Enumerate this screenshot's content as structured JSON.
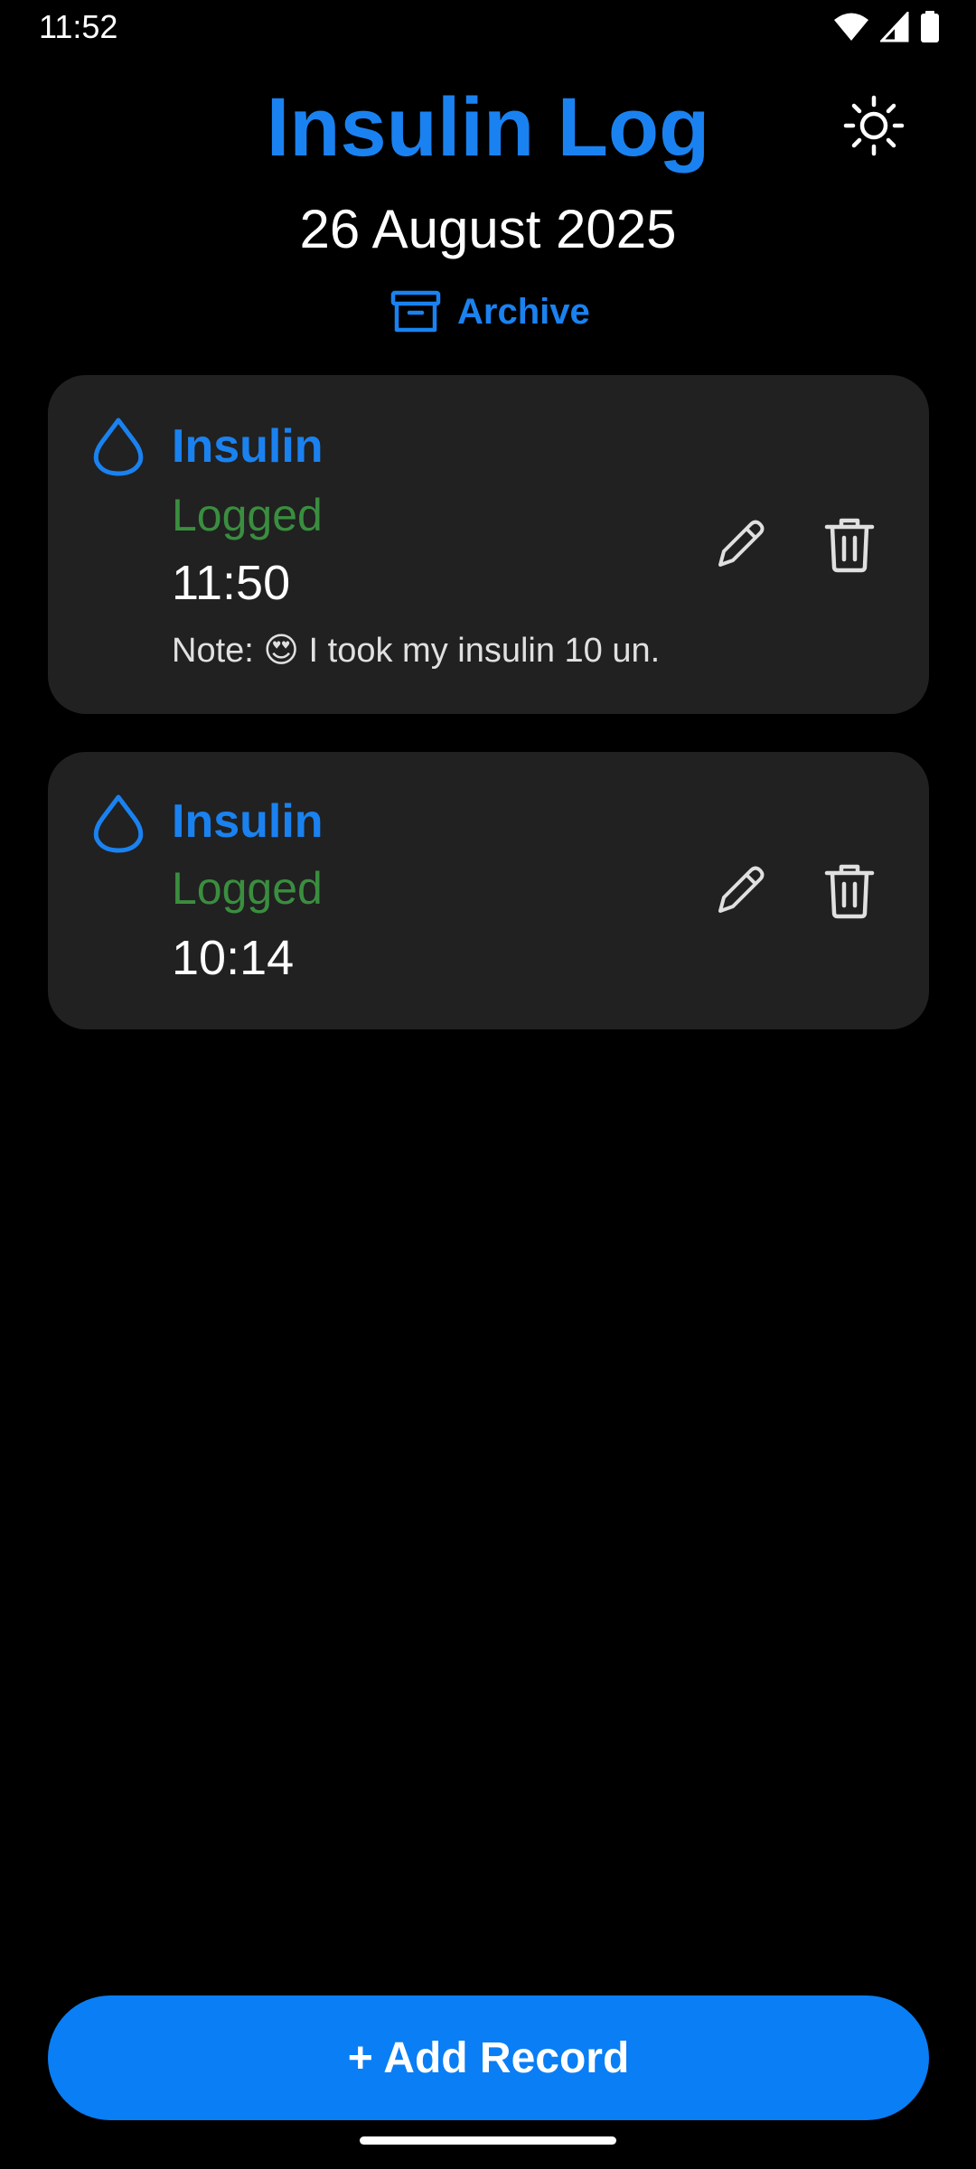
{
  "status_bar": {
    "time": "11:52",
    "icons": [
      "wifi-icon",
      "cellular-signal-icon",
      "battery-icon"
    ]
  },
  "header": {
    "title": "Insulin Log",
    "date": "26 August 2025",
    "archive_label": "Archive",
    "theme_icon": "sun-icon"
  },
  "records": [
    {
      "title": "Insulin",
      "status": "Logged",
      "time": "11:50",
      "note": "Note: 😍 I took my insulin 10 un."
    },
    {
      "title": "Insulin",
      "status": "Logged",
      "time": "10:14"
    }
  ],
  "add_button_label": "+ Add Record",
  "colors": {
    "accent": "#1a82f0",
    "button": "#0a7ef5",
    "logged_green": "#3a8e3f",
    "card_bg": "#212121",
    "background": "#000000"
  }
}
